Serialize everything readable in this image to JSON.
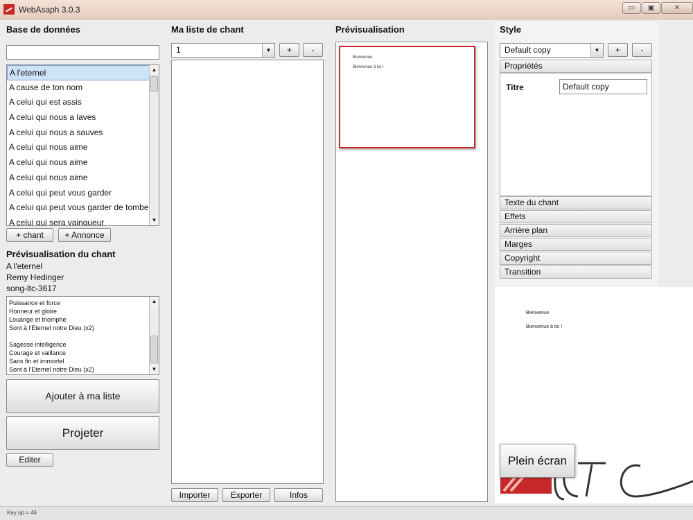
{
  "window": {
    "title": "WebAsaph 3.0.3",
    "minimize": "▭",
    "maximize": "▣",
    "close": "✕"
  },
  "database": {
    "title": "Base de données",
    "search_value": "",
    "songs": [
      "A l'eternel",
      "A cause de ton nom",
      "A celui qui est assis",
      "A celui qui nous a laves",
      "A celui qui nous a sauves",
      "A celui qui nous aime",
      "A celui qui nous aime",
      "A celui qui nous aime",
      "A celui qui peut vous garder",
      "A celui qui peut vous garder de tombe",
      "A celui qui sera vainqueur"
    ],
    "add_song_button": "+ chant",
    "add_announce_button": "+ Annonce"
  },
  "song_preview": {
    "title": "Prévisualisation du chant",
    "song_title": "A l'eternel",
    "author": "Remy Hedinger",
    "song_id": "song-ltc-3617",
    "lyrics": [
      "Puissance et force",
      "Honneur et gloire",
      "Louange et triomphe",
      "Sont à l'Eternel notre Dieu (x2)",
      "",
      "Sagesse intelligence",
      "Courage et vaillance",
      "Sans fin et immortel",
      "Sont à l'Eternel notre Dieu (x2)"
    ],
    "add_to_list_button": "Ajouter à ma liste",
    "project_button": "Projeter",
    "edit_button": "Editer"
  },
  "my_list": {
    "title": "Ma liste de chant",
    "selected": "1",
    "plus": "+",
    "minus": "-",
    "import_button": "Importer",
    "export_button": "Exporter",
    "info_button": "Infos"
  },
  "preview": {
    "title": "Prévisualisation",
    "slide_line1": "Bienvenue",
    "slide_line2": "Bienvenue à toi !"
  },
  "style": {
    "title": "Style",
    "selected": "Default copy",
    "plus": "+",
    "minus": "-",
    "properties_header": "Propriétés",
    "titre_label": "Titre",
    "titre_value": "Default copy",
    "sections": [
      "Texte du chant",
      "Effets",
      "Arrière plan",
      "Marges",
      "Copyright",
      "Transition"
    ]
  },
  "big_preview": {
    "line1": "Bienvenue",
    "line2": "Bienvenue à toi !",
    "fullscreen_button": "Plein écran"
  },
  "status": {
    "text": "Key up = 46"
  }
}
